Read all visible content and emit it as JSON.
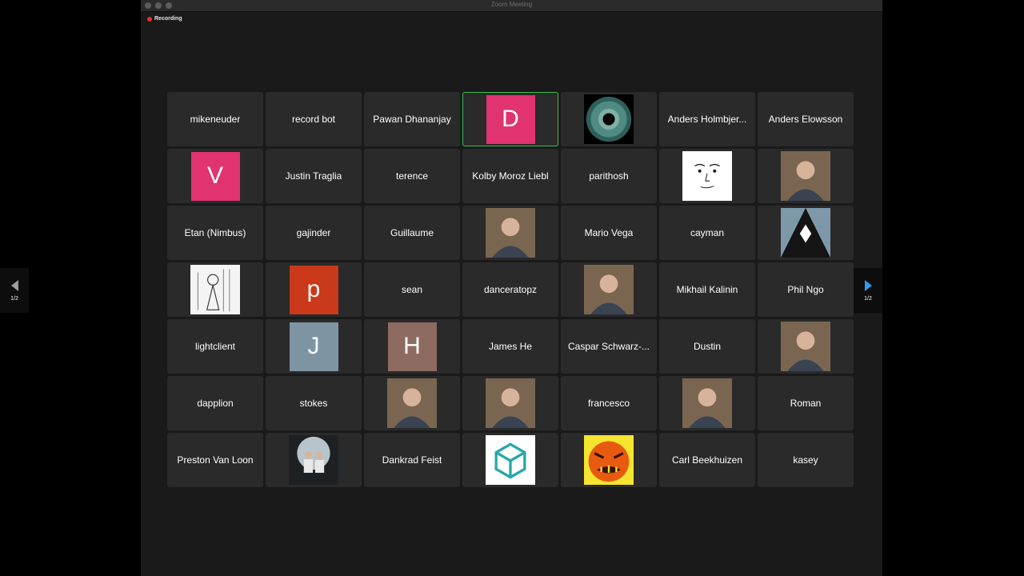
{
  "window": {
    "title": "Zoom Meeting",
    "recording_label": "Recording"
  },
  "pagination": {
    "left": "1/2",
    "right": "1/2"
  },
  "colors": {
    "active_speaker_border": "#3dbd4d",
    "recording_dot": "#e5302e",
    "nav_next_arrow": "#2e9bf0"
  },
  "participants": [
    {
      "type": "name",
      "name": "mikeneuder"
    },
    {
      "type": "name",
      "name": "record bot"
    },
    {
      "type": "name",
      "name": "Pawan Dhananjay"
    },
    {
      "type": "letter",
      "letter": "D",
      "color": "#e0336f",
      "active": true
    },
    {
      "type": "avatar",
      "icon": "eye-iris-avatar"
    },
    {
      "type": "name",
      "name": "Anders Holmbjer..."
    },
    {
      "type": "name",
      "name": "Anders Elowsson"
    },
    {
      "type": "letter",
      "letter": "V",
      "color": "#e0336f"
    },
    {
      "type": "name",
      "name": "Justin Traglia"
    },
    {
      "type": "name",
      "name": "terence"
    },
    {
      "type": "name",
      "name": "Kolby Moroz Liebl"
    },
    {
      "type": "name",
      "name": "parithosh"
    },
    {
      "type": "avatar",
      "icon": "face-sketch-avatar"
    },
    {
      "type": "avatar",
      "icon": "person-photo-avatar"
    },
    {
      "type": "name",
      "name": "Etan (Nimbus)"
    },
    {
      "type": "name",
      "name": "gajinder"
    },
    {
      "type": "name",
      "name": "Guillaume"
    },
    {
      "type": "avatar",
      "icon": "person-photo-avatar"
    },
    {
      "type": "name",
      "name": "Mario Vega"
    },
    {
      "type": "name",
      "name": "cayman"
    },
    {
      "type": "avatar",
      "icon": "triangle-diamond-avatar"
    },
    {
      "type": "avatar",
      "icon": "alice-illustration-avatar"
    },
    {
      "type": "letter",
      "letter": "p",
      "color": "#c9391a"
    },
    {
      "type": "name",
      "name": "sean"
    },
    {
      "type": "name",
      "name": "danceratopz"
    },
    {
      "type": "avatar",
      "icon": "person-photo-avatar"
    },
    {
      "type": "name",
      "name": "Mikhail Kalinin"
    },
    {
      "type": "name",
      "name": "Phil Ngo"
    },
    {
      "type": "name",
      "name": "lightclient"
    },
    {
      "type": "letter",
      "letter": "J",
      "color": "#7d94a3"
    },
    {
      "type": "letter",
      "letter": "H",
      "color": "#8e6b60"
    },
    {
      "type": "name",
      "name": "James He"
    },
    {
      "type": "name",
      "name": "Caspar Schwarz-..."
    },
    {
      "type": "name",
      "name": "Dustin"
    },
    {
      "type": "avatar",
      "icon": "person-photo-avatar"
    },
    {
      "type": "name",
      "name": "dapplion"
    },
    {
      "type": "name",
      "name": "stokes"
    },
    {
      "type": "avatar",
      "icon": "person-photo-avatar"
    },
    {
      "type": "avatar",
      "icon": "person-photo-avatar"
    },
    {
      "type": "name",
      "name": "francesco"
    },
    {
      "type": "avatar",
      "icon": "person-photo-avatar"
    },
    {
      "type": "name",
      "name": "Roman"
    },
    {
      "type": "name",
      "name": "Preston Van Loon"
    },
    {
      "type": "avatar",
      "icon": "two-people-photo-avatar"
    },
    {
      "type": "name",
      "name": "Dankrad Feist"
    },
    {
      "type": "avatar",
      "icon": "cube-logo-avatar"
    },
    {
      "type": "avatar",
      "icon": "angry-pumpkin-avatar"
    },
    {
      "type": "name",
      "name": "Carl Beekhuizen"
    },
    {
      "type": "name",
      "name": "kasey"
    }
  ]
}
